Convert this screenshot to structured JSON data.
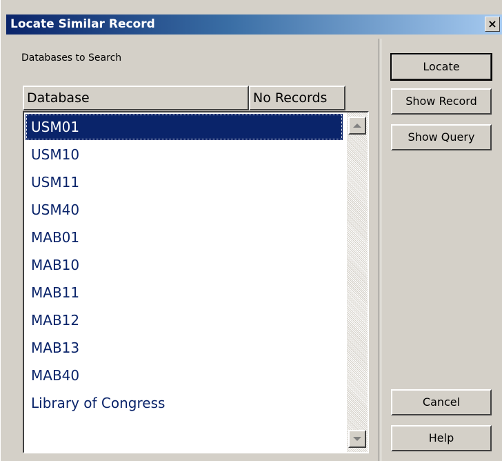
{
  "window": {
    "title": "Locate Similar Record",
    "close_label": "×"
  },
  "group": {
    "label": "Databases to Search"
  },
  "list": {
    "columns": [
      "Database",
      "No Records"
    ],
    "items": [
      "USM01",
      "USM10",
      "USM11",
      "USM40",
      "MAB01",
      "MAB10",
      "MAB11",
      "MAB12",
      "MAB13",
      "MAB40",
      "Library of Congress"
    ],
    "selected_index": 0
  },
  "buttons": {
    "locate": "Locate",
    "show_record": "Show Record",
    "show_query": "Show Query",
    "cancel": "Cancel",
    "help": "Help"
  },
  "colors": {
    "titlebar_start": "#0a246a",
    "titlebar_end": "#a6caf0",
    "selection": "#0a246a",
    "item_text": "#0a246a"
  }
}
